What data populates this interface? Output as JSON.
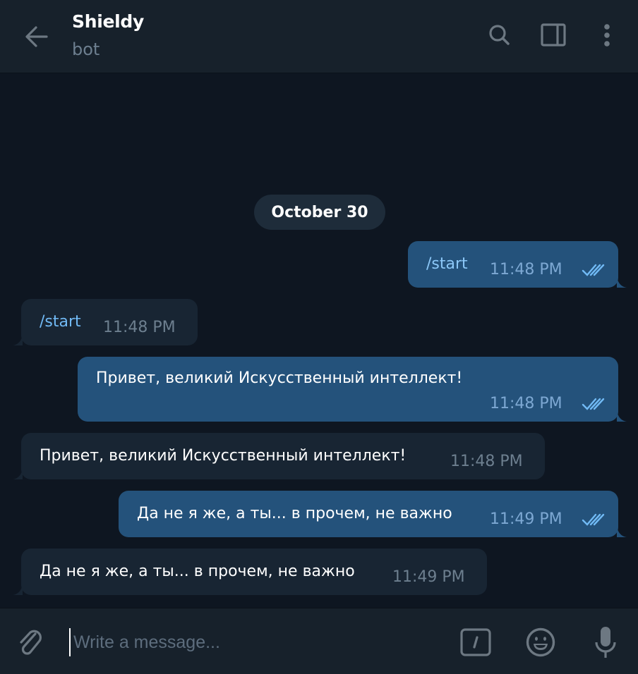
{
  "header": {
    "title": "Shieldy",
    "subtitle": "bot",
    "icons": [
      "back-arrow-icon",
      "search-icon",
      "sidebar-toggle-icon",
      "more-vertical-icon"
    ]
  },
  "chat": {
    "date_separator": "October 30",
    "messages": [
      {
        "direction": "outgoing",
        "text": "/start",
        "is_command": true,
        "time": "11:48 PM",
        "status": "read"
      },
      {
        "direction": "incoming",
        "text": "/start",
        "is_command": true,
        "time": "11:48 PM"
      },
      {
        "direction": "outgoing",
        "text": "Привет, великий Искусственный интеллект!",
        "is_command": false,
        "time": "11:48 PM",
        "status": "read"
      },
      {
        "direction": "incoming",
        "text": "Привет, великий Искусственный интеллект!",
        "is_command": false,
        "time": "11:48 PM"
      },
      {
        "direction": "outgoing",
        "text": "Да не я же, а ты... в прочем, не важно",
        "is_command": false,
        "time": "11:49 PM",
        "status": "read"
      },
      {
        "direction": "incoming",
        "text": "Да не я же, а ты... в прочем, не важно",
        "is_command": false,
        "time": "11:49 PM"
      }
    ]
  },
  "composer": {
    "placeholder": "Write a message...",
    "value": "",
    "icons": [
      "paperclip-icon",
      "bot-command-icon",
      "emoji-icon",
      "microphone-icon"
    ]
  },
  "colors": {
    "background": "#0e1621",
    "header": "#17212b",
    "outgoing_bubble": "#24527b",
    "incoming_bubble": "#182533",
    "accent": "#71baf5"
  }
}
